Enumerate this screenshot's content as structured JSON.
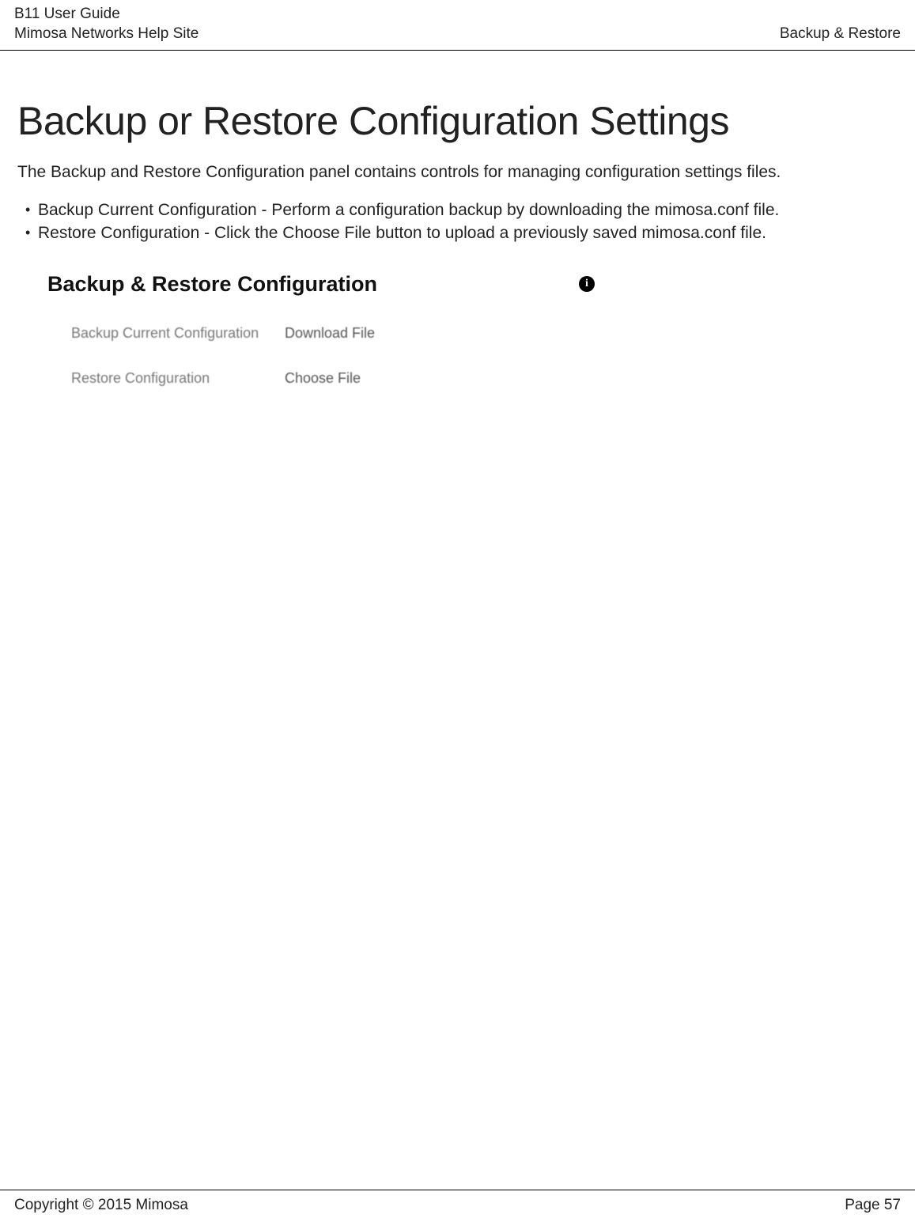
{
  "header": {
    "line1": "B11 User Guide",
    "line2": "Mimosa Networks Help Site",
    "right": "Backup & Restore"
  },
  "page": {
    "heading": "Backup or Restore Configuration Settings",
    "intro": "The Backup and Restore Configuration panel contains controls for managing configuration settings files.",
    "bullets": [
      "Backup Current Configuration - Perform a configuration backup by downloading the mimosa.conf file.",
      "Restore Configuration - Click the Choose File button to upload a previously saved mimosa.conf file."
    ],
    "panel": {
      "title": "Backup & Restore Configuration",
      "rows": [
        {
          "label": "Backup Current Configuration",
          "action": "Download File"
        },
        {
          "label": "Restore Configuration",
          "action": "Choose File"
        }
      ]
    }
  },
  "footer": {
    "left": "Copyright © 2015 Mimosa",
    "right": "Page 57"
  }
}
